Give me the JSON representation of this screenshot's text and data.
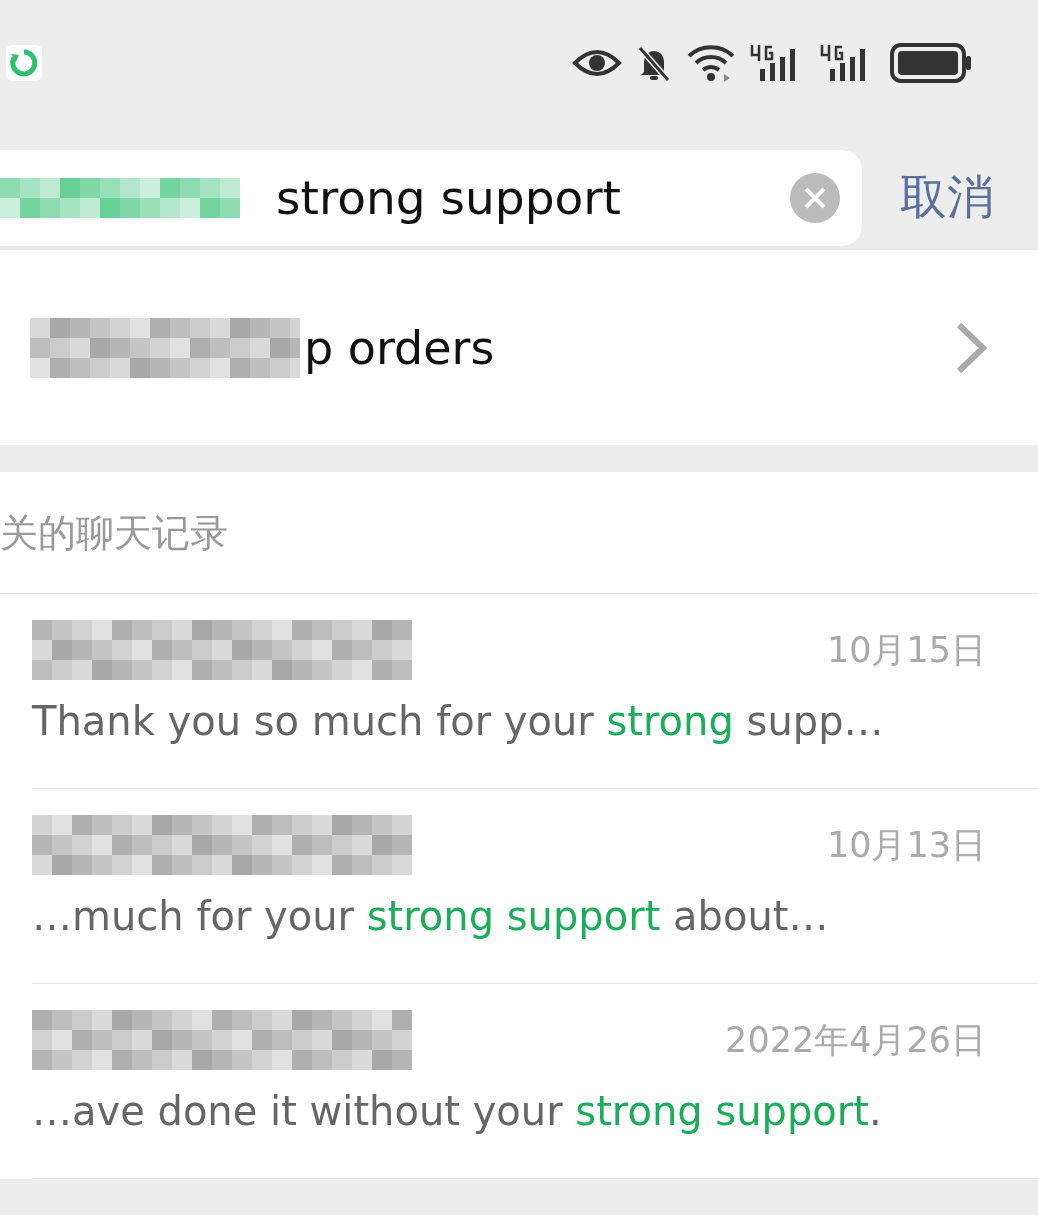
{
  "search": {
    "value": "strong support",
    "cancel": "取消"
  },
  "top_result": {
    "title": "p orders"
  },
  "chat_section": {
    "heading": "关的聊天记录",
    "results": [
      {
        "date": "10月15日",
        "snippet": [
          {
            "text": "Thank you so much for your ",
            "highlight": false
          },
          {
            "text": "strong",
            "highlight": true
          },
          {
            "text": " supp…",
            "highlight": false
          }
        ]
      },
      {
        "date": "10月13日",
        "snippet": [
          {
            "text": "…much for your ",
            "highlight": false
          },
          {
            "text": "strong support",
            "highlight": true
          },
          {
            "text": " about…",
            "highlight": false
          }
        ]
      },
      {
        "date": "2022年4月26日",
        "snippet": [
          {
            "text": "…ave done it without your ",
            "highlight": false
          },
          {
            "text": "strong support",
            "highlight": true
          },
          {
            "text": ".",
            "highlight": false
          }
        ]
      }
    ]
  }
}
